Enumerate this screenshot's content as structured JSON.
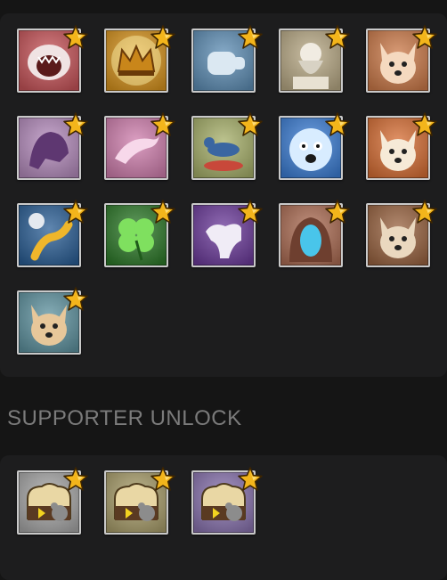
{
  "heading": "SUPPORTER UNLOCK",
  "achievements": [
    {
      "icon": "shark-icon",
      "bg": "#c8555a",
      "fg": "#f0e3e3"
    },
    {
      "icon": "crown-icon",
      "bg": "#d8941e",
      "fg": "#6a3a08"
    },
    {
      "icon": "fist-icon",
      "bg": "#5f8fb6",
      "fg": "#dbe8f2"
    },
    {
      "icon": "bearded-man-icon",
      "bg": "#b9aa86",
      "fg": "#f1ece2"
    },
    {
      "icon": "explorer-dog-icon",
      "bg": "#cd7b4a",
      "fg": "#f5d9bf"
    },
    {
      "icon": "purple-beast-icon",
      "bg": "#b58cbd",
      "fg": "#5e3771"
    },
    {
      "icon": "dolphin-icon",
      "bg": "#d07fae",
      "fg": "#f7d8ea"
    },
    {
      "icon": "running-bird-icon",
      "bg": "#a7b06a",
      "fg": "#3a66a1"
    },
    {
      "icon": "fluffy-creature-icon",
      "bg": "#3d7fd6",
      "fg": "#d8ecff"
    },
    {
      "icon": "fox-icon",
      "bg": "#d86f35",
      "fg": "#f6ead7"
    },
    {
      "icon": "diamond-worm-icon",
      "bg": "#2b5f96",
      "fg": "#efb62b"
    },
    {
      "icon": "clover-icon",
      "bg": "#2e7a2a",
      "fg": "#7fe05f"
    },
    {
      "icon": "ghost-camel-icon",
      "bg": "#6d3c9c",
      "fg": "#f0ecf6"
    },
    {
      "icon": "portal-cave-icon",
      "bg": "#ae6e55",
      "fg": "#49c5ea"
    },
    {
      "icon": "husky-icon",
      "bg": "#9a6441",
      "fg": "#ead8bf"
    },
    {
      "icon": "cat-icon",
      "bg": "#5f93a0",
      "fg": "#e7c79a"
    }
  ],
  "supporter": [
    {
      "icon": "bread-mouse-icon",
      "bg": "#a8a8a8",
      "fg": "#e9d7a4"
    },
    {
      "icon": "bread-mouse-icon",
      "bg": "#aa9f6c",
      "fg": "#e9d7a4"
    },
    {
      "icon": "bread-mouse-icon",
      "bg": "#8a74b0",
      "fg": "#e9d7a4"
    }
  ]
}
